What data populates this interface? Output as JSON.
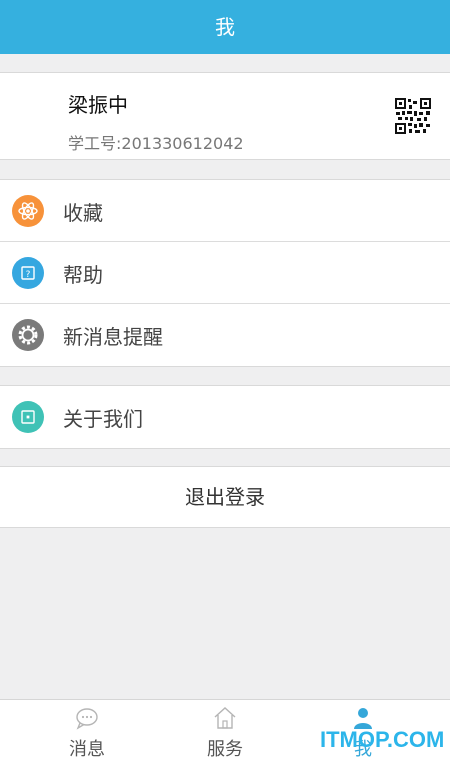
{
  "header": {
    "title": "我"
  },
  "profile": {
    "name": "梁振中",
    "id_label": "学工号:",
    "id_value": "201330612042"
  },
  "menu_group_1": [
    {
      "label": "收藏",
      "icon": "atom-icon",
      "color": "#f7923a"
    },
    {
      "label": "帮助",
      "icon": "help-icon",
      "color": "#35a7e0"
    },
    {
      "label": "新消息提醒",
      "icon": "gear-icon",
      "color": "#7a7a7a"
    }
  ],
  "menu_group_2": [
    {
      "label": "关于我们",
      "icon": "info-icon",
      "color": "#3fc2b6"
    }
  ],
  "logout": {
    "label": "退出登录"
  },
  "tabbar": {
    "tabs": [
      {
        "label": "消息",
        "icon": "chat-bubble-icon"
      },
      {
        "label": "服务",
        "icon": "home-icon"
      },
      {
        "label": "我",
        "icon": "person-icon",
        "active": true
      }
    ]
  },
  "watermark": {
    "text": "ITMOP.COM"
  },
  "colors": {
    "accent": "#35b0df",
    "background": "#efeff0"
  }
}
